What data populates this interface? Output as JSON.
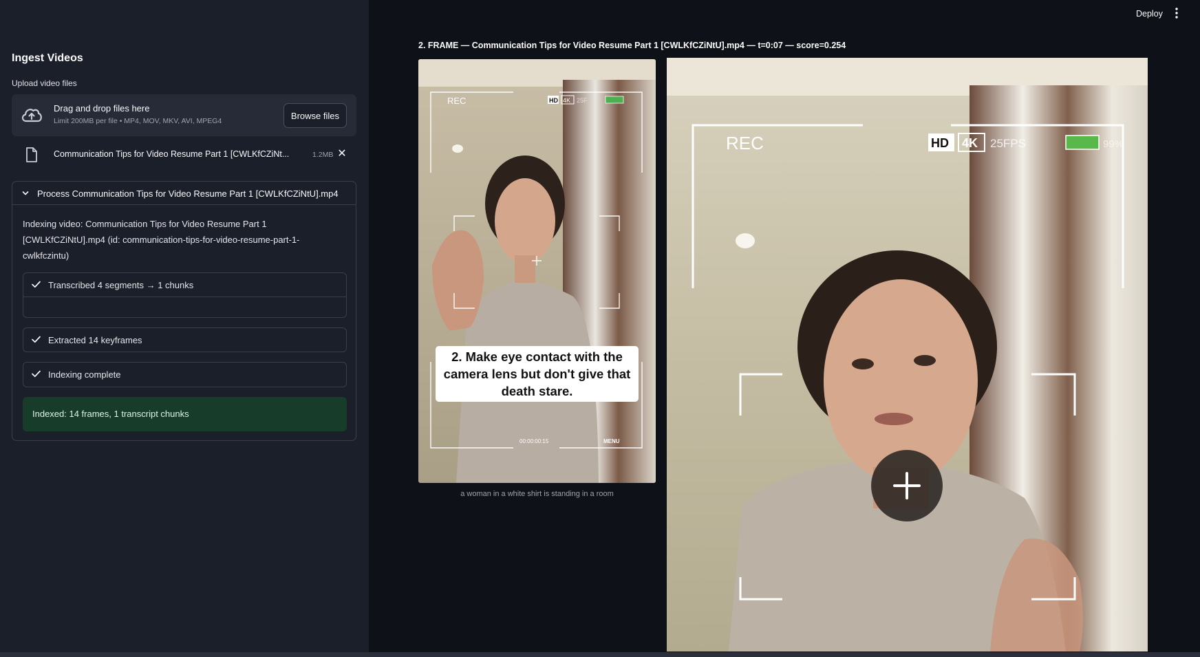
{
  "sidebar": {
    "title": "Ingest Videos",
    "upload_label": "Upload video files",
    "dropzone": {
      "main_text": "Drag and drop files here",
      "limit_text": "Limit 200MB per file • MP4, MOV, MKV, AVI, MPEG4",
      "browse_label": "Browse files"
    },
    "file": {
      "name": "Communication Tips for Video Resume Part 1 [CWLKfCZiNt...",
      "size": "1.2MB"
    },
    "expander": {
      "title": "Process Communication Tips for Video Resume Part 1 [CWLKfCZiNtU].mp4",
      "indexing_text": "Indexing video: Communication Tips for Video Resume Part 1 [CWLKfCZiNtU].mp4 (id: communication-tips-for-video-resume-part-1-cwlkfczintu)",
      "steps": [
        {
          "label": "Transcribed 4 segments → 1 chunks"
        },
        {
          "label": "Extracted 14 keyframes"
        },
        {
          "label": "Indexing complete"
        }
      ],
      "success": "Indexed: 14 frames, 1 transcript chunks"
    }
  },
  "header": {
    "deploy_label": "Deploy",
    "menu_icon": "kebab-icon"
  },
  "main": {
    "frame_title": "2. FRAME — Communication Tips for Video Resume Part 1 [CWLKfCZiNtU].mp4 — t=0:07 — score=0.254",
    "thumbnail": {
      "rec": "REC",
      "hd": "HD",
      "fourk": "4K",
      "fps": "25F",
      "subtitle": "2. Make eye contact with the camera lens but don't give that death stare.",
      "timecode": "00:00:00:15",
      "menu": "MENU"
    },
    "caption": "a woman in a white shirt is standing in a room",
    "large": {
      "rec": "REC",
      "hd": "HD",
      "fourk": "4K",
      "fps": "25FPS",
      "battery": "99%"
    }
  },
  "colors": {
    "bg": "#0e1117",
    "sidebar": "#1b1f2a",
    "success_bg": "#173c2a",
    "border": "#3a3f4b"
  }
}
